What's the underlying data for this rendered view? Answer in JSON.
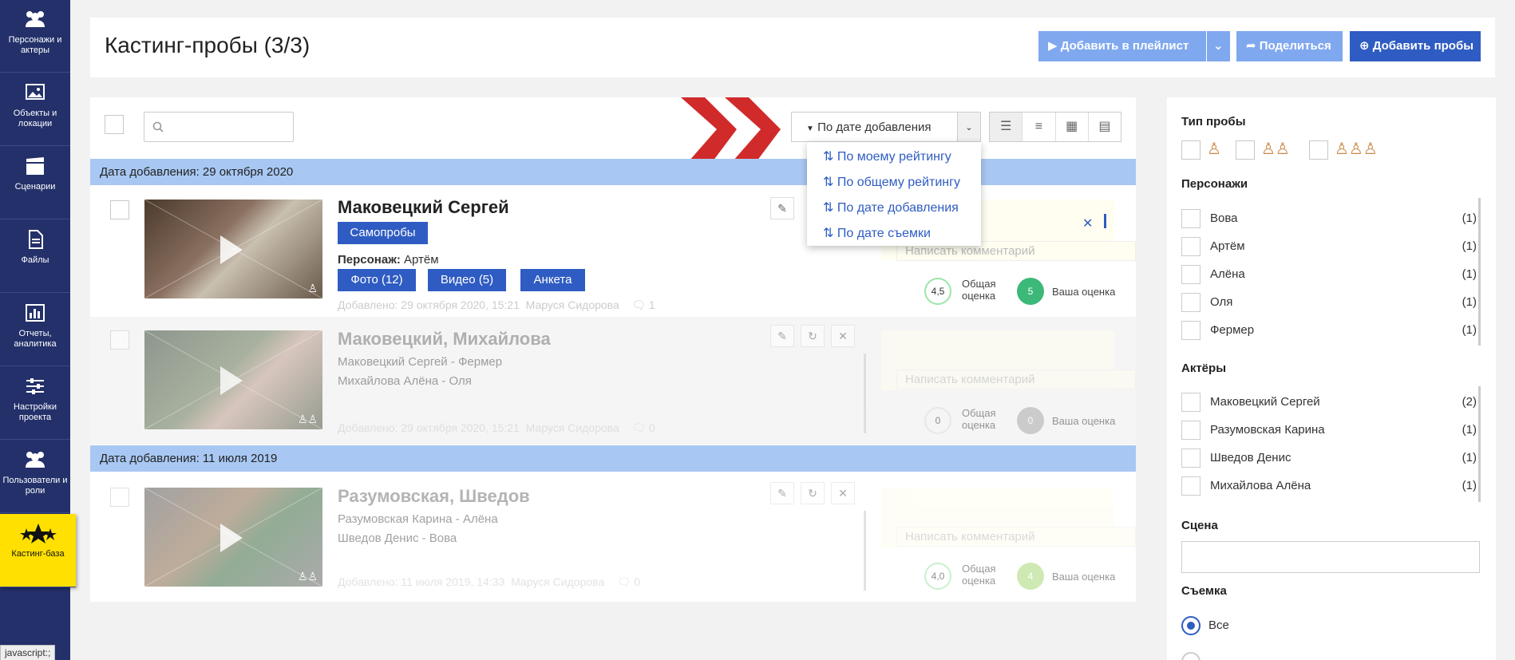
{
  "sidebar": {
    "items": [
      {
        "label": "Персонажи и актеры",
        "icon": "people-icon"
      },
      {
        "label": "Объекты и локации",
        "icon": "image-icon"
      },
      {
        "label": "Сценарии",
        "icon": "clapperboard-icon"
      },
      {
        "label": "Файлы",
        "icon": "file-icon"
      },
      {
        "label": "Отчеты, аналитика",
        "icon": "chart-icon"
      },
      {
        "label": "Настройки проекта",
        "icon": "sliders-icon"
      },
      {
        "label": "Пользователи и роли",
        "icon": "users-icon"
      },
      {
        "label": "Кастинг-база",
        "icon": "stars-icon"
      }
    ],
    "status": "javascript:;"
  },
  "header": {
    "title": "Кастинг-пробы (3/3)",
    "add_playlist": "Добавить в плейлист",
    "share": "Поделиться",
    "add_probes": "Добавить пробы"
  },
  "toolbar": {
    "sort_label": "По дате добавления",
    "sort_options": [
      "По моему рейтингу",
      "По общему рейтингу",
      "По дате добавления",
      "По дате съемки"
    ]
  },
  "groups": [
    "Дата добавления: 29 октября 2020",
    "Дата добавления: 11 июля 2019"
  ],
  "comment_placeholder": "Написать комментарий",
  "labels": {
    "overall": "Общая",
    "overall2": "оценка",
    "yours": "Ваша оценка",
    "character": "Персонаж:"
  },
  "entries": [
    {
      "name": "Маковецкий Сергей",
      "badge": "Самопробы",
      "character": "Артём",
      "buttons": [
        "Фото (12)",
        "Видео (5)",
        "Анкета"
      ],
      "added": "Добавлено: 29 октября 2020, 15:21",
      "author": "Маруся Сидорова",
      "comments": "1",
      "overall": "4,5",
      "yours": "5"
    },
    {
      "name": "Маковецкий, Михайлова",
      "lines": [
        "Маковецкий Сергей - Фермер",
        "Михайлова Алёна - Оля"
      ],
      "added": "Добавлено: 29 октября 2020, 15:21",
      "author": "Маруся Сидорова",
      "comments": "0",
      "overall": "0",
      "yours": "0"
    },
    {
      "name": "Разумовская, Шведов",
      "lines": [
        "Разумовская Карина - Алёна",
        "Шведов Денис - Вова"
      ],
      "added": "Добавлено: 11 июля 2019, 14:33",
      "author": "Маруся Сидорова",
      "comments": "0",
      "overall": "4,0",
      "yours": "4"
    }
  ],
  "filters": {
    "type_title": "Тип пробы",
    "characters_title": "Персонажи",
    "characters": [
      {
        "label": "Вова",
        "count": "(1)"
      },
      {
        "label": "Артём",
        "count": "(1)"
      },
      {
        "label": "Алёна",
        "count": "(1)"
      },
      {
        "label": "Оля",
        "count": "(1)"
      },
      {
        "label": "Фермер",
        "count": "(1)"
      }
    ],
    "actors_title": "Актёры",
    "actors": [
      {
        "label": "Маковецкий Сергей",
        "count": "(2)"
      },
      {
        "label": "Разумовская Карина",
        "count": "(1)"
      },
      {
        "label": "Шведов Денис",
        "count": "(1)"
      },
      {
        "label": "Михайлова Алёна",
        "count": "(1)"
      }
    ],
    "scene_title": "Сцена",
    "shoot_title": "Съемка",
    "shoot_all": "Все"
  },
  "colors": {
    "primary": "#2f5cc2",
    "light_blue": "#7fa8ef",
    "sidebar": "#23306a",
    "accent": "#ffe000",
    "green": "#3cb878",
    "arrow": "#d12a2a"
  }
}
